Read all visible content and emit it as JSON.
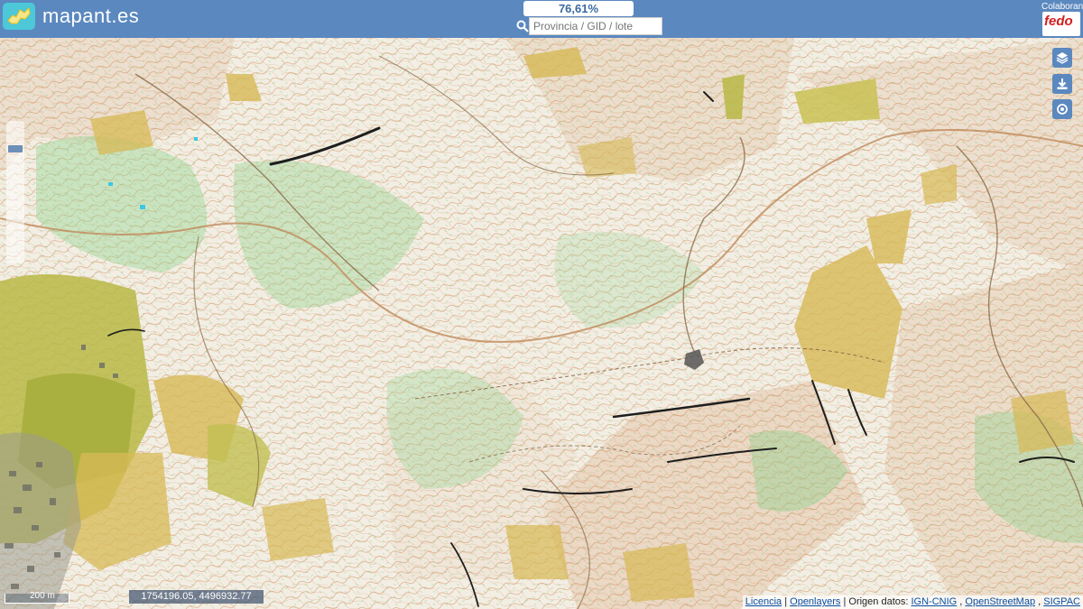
{
  "header": {
    "site_title": "mapant.es",
    "progress": "76,61%",
    "search": {
      "placeholder": "Provincia / GID / lote",
      "value": ""
    },
    "collaborators_label": "Colaboran",
    "collaborator_logo_text": "fedo"
  },
  "map": {
    "scale_label": "200 m",
    "coordinates": "1754196.05, 4496932.77",
    "attribution": {
      "licencia": "Licencia",
      "openlayers": "Openlayers",
      "origen_prefix": "Origen datos:",
      "ign": "IGN-CNIG",
      "osm": "OpenStreetMap",
      "sigpac": "SIGPAC"
    },
    "controls": [
      "layers-icon",
      "download-icon",
      "locate-icon"
    ]
  },
  "colors": {
    "header_bg": "#5b88bf",
    "logo_bg": "#4cc8d8",
    "map_bg": "#f4efe6",
    "vegetation_green": "#8fd18a",
    "open_land_yellow": "#d7b956",
    "contour_brown": "#c7783a",
    "collab_red": "#d11f1f"
  }
}
